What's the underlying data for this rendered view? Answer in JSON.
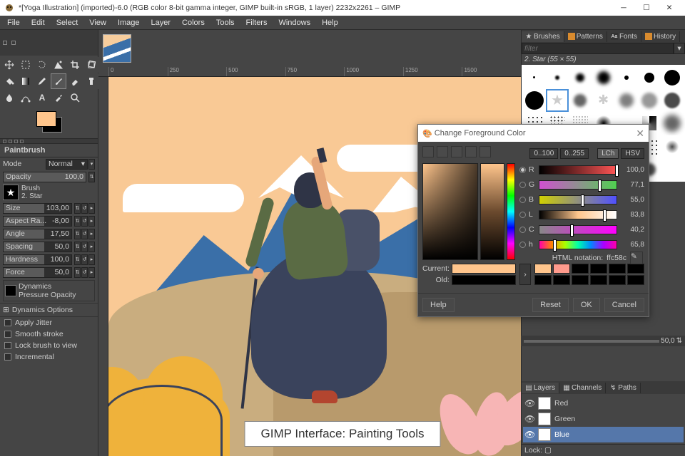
{
  "titlebar": {
    "text": "*[Yoga Illustration] (imported)-6.0 (RGB color 8-bit gamma integer, GIMP built-in sRGB, 1 layer) 2232x2261 – GIMP"
  },
  "menu": [
    "File",
    "Edit",
    "Select",
    "View",
    "Image",
    "Layer",
    "Colors",
    "Tools",
    "Filters",
    "Windows",
    "Help"
  ],
  "ruler_ticks": [
    "0",
    "250",
    "500",
    "750",
    "1000",
    "1250",
    "1500"
  ],
  "toolopts": {
    "title": "Paintbrush",
    "mode_label": "Mode",
    "mode_value": "Normal",
    "opacity_label": "Opacity",
    "opacity_value": "100,0",
    "brush_label": "Brush",
    "brush_name": "2. Star",
    "rows": [
      {
        "label": "Size",
        "value": "103,00"
      },
      {
        "label": "Aspect Ra...",
        "value": "-8,00"
      },
      {
        "label": "Angle",
        "value": "17,50"
      },
      {
        "label": "Spacing",
        "value": "50,0"
      },
      {
        "label": "Hardness",
        "value": "100,0"
      },
      {
        "label": "Force",
        "value": "50,0"
      }
    ],
    "dynamics_label": "Dynamics",
    "dynamics_value": "Pressure Opacity",
    "dyn_options": "Dynamics Options",
    "checks": [
      "Apply Jitter",
      "Smooth stroke",
      "Lock brush to view",
      "Incremental"
    ]
  },
  "right": {
    "tabs": [
      "Brushes",
      "Patterns",
      "Fonts",
      "History"
    ],
    "filter_placeholder": "filter",
    "brush_label": "2. Star (55 × 55)",
    "layer_tabs": [
      "Layers",
      "Channels",
      "Paths"
    ],
    "layers": [
      "Red",
      "Green",
      "Blue"
    ],
    "lock_label": "Lock:",
    "zoom": "50,0"
  },
  "dialog": {
    "title": "Change Foreground Color",
    "ranges": [
      "0..100",
      "0..255"
    ],
    "modes": [
      "LCh",
      "HSV"
    ],
    "sliders": [
      {
        "k": "R",
        "v": "100,0",
        "cls": "r",
        "mk": 98
      },
      {
        "k": "G",
        "v": "77,1",
        "cls": "g",
        "mk": 76
      },
      {
        "k": "B",
        "v": "55,0",
        "cls": "b",
        "mk": 54
      },
      {
        "k": "L",
        "v": "83,8",
        "cls": "l",
        "mk": 82
      },
      {
        "k": "C",
        "v": "40,2",
        "cls": "c",
        "mk": 40
      },
      {
        "k": "h",
        "v": "65,8",
        "cls": "h",
        "mk": 18
      }
    ],
    "html_label": "HTML notation:",
    "html_value": "ffc58c",
    "current_label": "Current:",
    "old_label": "Old:",
    "current_color": "#ffc58c",
    "old_color": "#000000",
    "swatches": [
      "#ffc58c",
      "#ff9a8c",
      "#000",
      "#000",
      "#000",
      "#000",
      "#000",
      "#000",
      "#000",
      "#000",
      "#000",
      "#000"
    ],
    "buttons": {
      "help": "Help",
      "reset": "Reset",
      "ok": "OK",
      "cancel": "Cancel"
    }
  },
  "caption": "GIMP Interface: Painting Tools",
  "foreground_color": "#ffc58c"
}
